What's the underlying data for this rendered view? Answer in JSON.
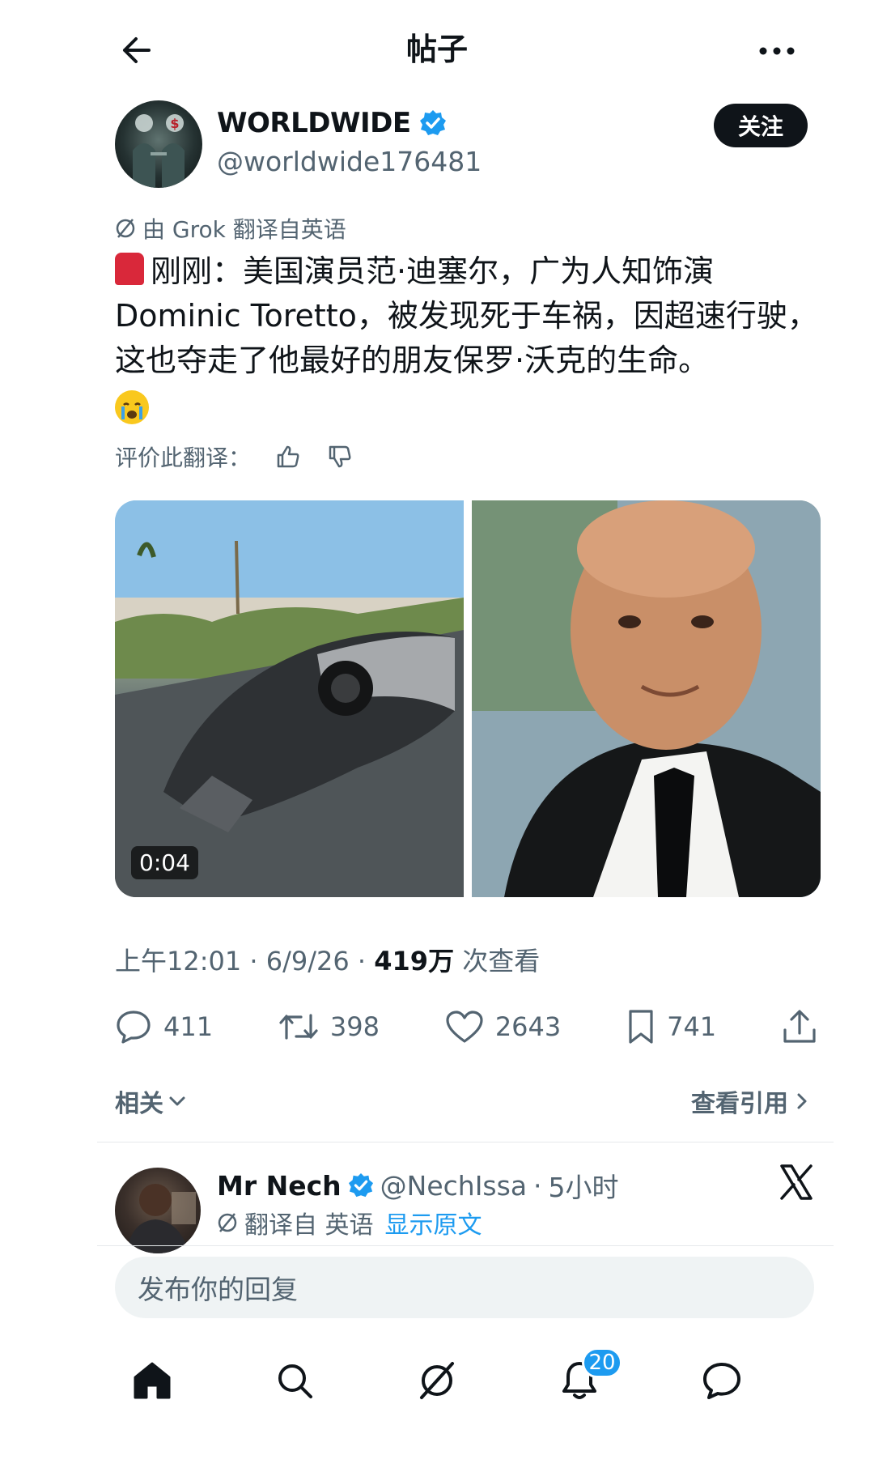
{
  "header": {
    "title": "帖子"
  },
  "author": {
    "name": "WORLDWIDE",
    "handle": "@worldwide176481",
    "follow_label": "关注"
  },
  "translation": {
    "note": "由 Grok 翻译自英语",
    "rate_label": "评价此翻译："
  },
  "post": {
    "text": "刚刚：美国演员范·迪塞尔，广为人知饰演 Dominic Toretto，被发现死于车祸，因超速行驶，这也夺走了他最好的朋友保罗·沃克的生命。"
  },
  "media": {
    "video_duration": "0:04"
  },
  "meta": {
    "time": "上午12:01",
    "date": "6/9/26",
    "views_count": "419万",
    "views_label": "次查看"
  },
  "actions": {
    "replies": "411",
    "reposts": "398",
    "likes": "2643",
    "bookmarks": "741"
  },
  "related": {
    "label": "相关",
    "quotes_label": "查看引用"
  },
  "reply_preview": {
    "name": "Mr Nech",
    "handle": "@NechIssa",
    "time": "5小时",
    "translated_label": "翻译自 英语",
    "show_original": "显示原文"
  },
  "reply_box": {
    "placeholder": "发布你的回复"
  },
  "nav": {
    "notifications_badge": "20"
  },
  "colors": {
    "accent": "#1d9bf0",
    "text": "#0f1419",
    "muted": "#536471"
  }
}
